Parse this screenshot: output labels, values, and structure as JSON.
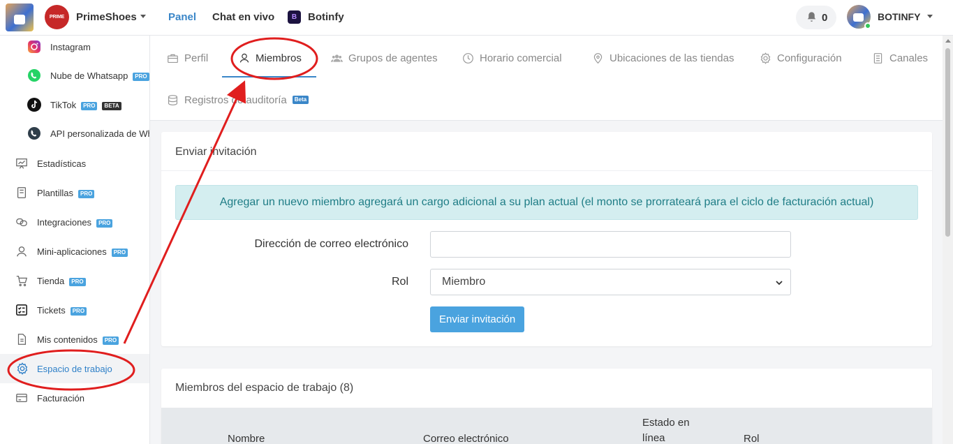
{
  "topbar": {
    "brand_logo_text": "PRIME",
    "brand_name": "PrimeShoes",
    "nav": [
      {
        "label": "Panel",
        "active": true
      },
      {
        "label": "Chat en vivo"
      },
      {
        "label": "Botinfy"
      }
    ],
    "botinfy_icon_letter": "B",
    "notification_count": "0",
    "user_name": "BOTINFY"
  },
  "sidebar": {
    "items": [
      {
        "label": "Instagram",
        "icon": "instagram-icon"
      },
      {
        "label": "Nube de Whatsapp",
        "badge": "PRO",
        "icon": "whatsapp-icon"
      },
      {
        "label": "TikTok",
        "badge": "PRO",
        "badge2": "BETA",
        "icon": "tiktok-icon"
      },
      {
        "label": "API personalizada de WhatsApp",
        "icon": "whatsapp-api-icon"
      },
      {
        "label": "Estadísticas",
        "icon": "statistics-icon"
      },
      {
        "label": "Plantillas",
        "badge": "PRO",
        "icon": "templates-icon"
      },
      {
        "label": "Integraciones",
        "badge": "PRO",
        "icon": "integrations-icon"
      },
      {
        "label": "Mini-aplicaciones",
        "badge": "PRO",
        "icon": "mini-apps-icon"
      },
      {
        "label": "Tienda",
        "badge": "PRO",
        "icon": "cart-icon"
      },
      {
        "label": "Tickets",
        "badge": "PRO",
        "icon": "tickets-icon"
      },
      {
        "label": "Mis contenidos",
        "badge": "PRO",
        "icon": "document-icon"
      },
      {
        "label": "Espacio de trabajo",
        "active": true,
        "icon": "gear-icon"
      },
      {
        "label": "Facturación",
        "icon": "billing-icon"
      }
    ]
  },
  "tabs": {
    "items": [
      {
        "label": "Perfil",
        "icon": "briefcase-icon"
      },
      {
        "label": "Miembros",
        "icon": "user-icon",
        "active": true
      },
      {
        "label": "Grupos de agentes",
        "icon": "users-icon"
      },
      {
        "label": "Horario comercial",
        "icon": "clock-icon"
      },
      {
        "label": "Ubicaciones de las tiendas",
        "icon": "location-pin-icon"
      },
      {
        "label": "Configuración",
        "icon": "gear-icon"
      },
      {
        "label": "Canales",
        "icon": "channels-icon"
      },
      {
        "label": "Registros de auditoría",
        "icon": "database-icon",
        "badge": "Beta"
      }
    ]
  },
  "invite": {
    "title": "Enviar invitación",
    "alert": "Agregar un nuevo miembro agregará un cargo adicional a su plan actual (el monto se prorrateará para el ciclo de facturación actual)",
    "email_label": "Dirección de correo electrónico",
    "email_value": "",
    "role_label": "Rol",
    "role_selected": "Miembro",
    "submit_label": "Enviar invitación"
  },
  "members": {
    "title": "Miembros del espacio de trabajo (8)",
    "columns": [
      "Nombre",
      "Correo electrónico",
      "Estado en línea",
      "Rol"
    ]
  },
  "colors": {
    "accent": "#3a86c8",
    "button": "#4aa3df",
    "alert_bg": "#d4eef0",
    "annotation": "#e01e1e"
  }
}
